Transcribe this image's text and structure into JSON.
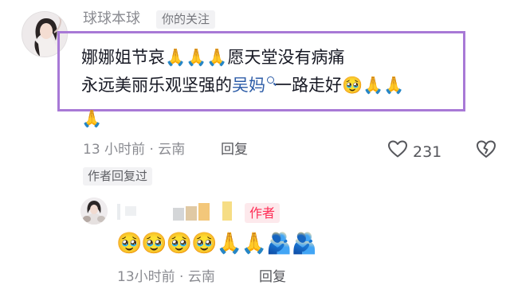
{
  "comment": {
    "username": "球球本球",
    "follow_badge": "你的关注",
    "text_line1": "娜娜姐节哀🙏🙏🙏愿天堂没有病痛",
    "text_line2_pre": "永远美丽乐观坚强的",
    "mention": "吴妈",
    "text_line2_post": "一路走好🥹🙏🙏",
    "text_line3": "🙏",
    "time_location": "13 小时前 · 云南",
    "reply_label": "回复",
    "like_count": "231",
    "author_replied_label": "作者回复过"
  },
  "reply": {
    "author_badge": "作者",
    "emojis": "🥹🥹🥹🥹🙏🙏🫂🫂",
    "time_location": "13小时前 · 云南",
    "reply_label": "回复"
  },
  "colors": {
    "highlight_border": "#a879d6",
    "mention": "#2f5ea8",
    "author_badge": "#fe2c55"
  },
  "icons": {
    "like": "heart-outline-icon",
    "dislike": "broken-heart-icon",
    "search": "search-icon"
  }
}
